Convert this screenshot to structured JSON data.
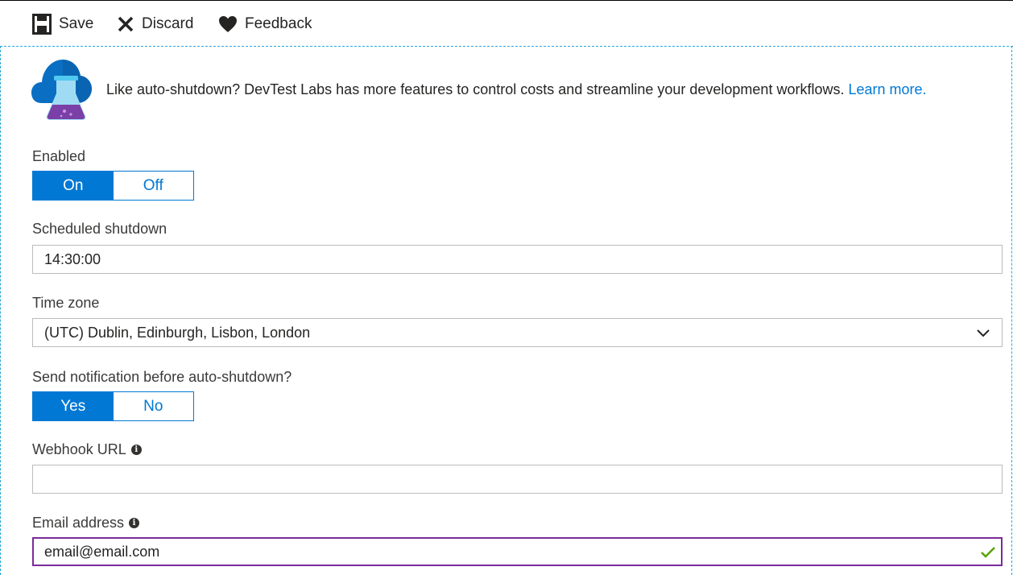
{
  "toolbar": {
    "save_label": "Save",
    "discard_label": "Discard",
    "feedback_label": "Feedback"
  },
  "banner": {
    "text": "Like auto-shutdown? DevTest Labs has more features to control costs and streamline your development workflows.",
    "link": "Learn more.",
    "icon": "devtest-labs-icon"
  },
  "enabled": {
    "label": "Enabled",
    "options": [
      "On",
      "Off"
    ],
    "selected": "On"
  },
  "scheduled_shutdown": {
    "label": "Scheduled shutdown",
    "value": "14:30:00"
  },
  "time_zone": {
    "label": "Time zone",
    "value": "(UTC) Dublin, Edinburgh, Lisbon, London"
  },
  "notification": {
    "label": "Send notification before auto-shutdown?",
    "options": [
      "Yes",
      "No"
    ],
    "selected": "Yes"
  },
  "webhook": {
    "label": "Webhook URL",
    "value": ""
  },
  "email": {
    "label": "Email address",
    "value": "email@email.com"
  },
  "colors": {
    "accent": "#0078d4",
    "focus_border": "#7a2b9a",
    "valid_check": "#57a300",
    "dashed_border": "#2aa7d8"
  }
}
